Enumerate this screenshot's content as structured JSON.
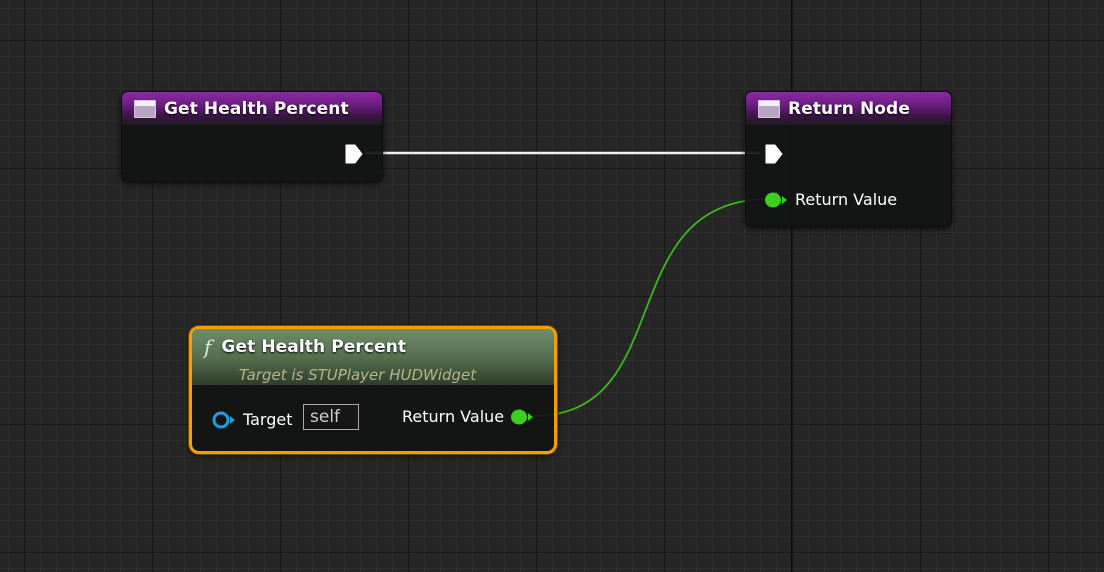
{
  "graph": {
    "entry_node": {
      "title": "Get Health Percent"
    },
    "return_node": {
      "title": "Return Node",
      "return_pin_label": "Return Value"
    },
    "call_node": {
      "title": "Get Health Percent",
      "subtitle": "Target is STUPlayer HUDWidget",
      "target_label": "Target",
      "target_value": "self",
      "return_pin_label": "Return Value",
      "function_icon": "f"
    }
  },
  "colors": {
    "entry_header": "#7a2490",
    "call_header": "#5f7a58",
    "selection_outline": "#f0a000",
    "float_pin": "#3bd01e",
    "object_pin": "#1e9fe0",
    "exec_wire": "#ffffff",
    "data_wire": "#3bb81c"
  },
  "icons": {
    "entry": "function-entry-icon",
    "return": "function-result-icon",
    "call": "function-f-icon"
  }
}
